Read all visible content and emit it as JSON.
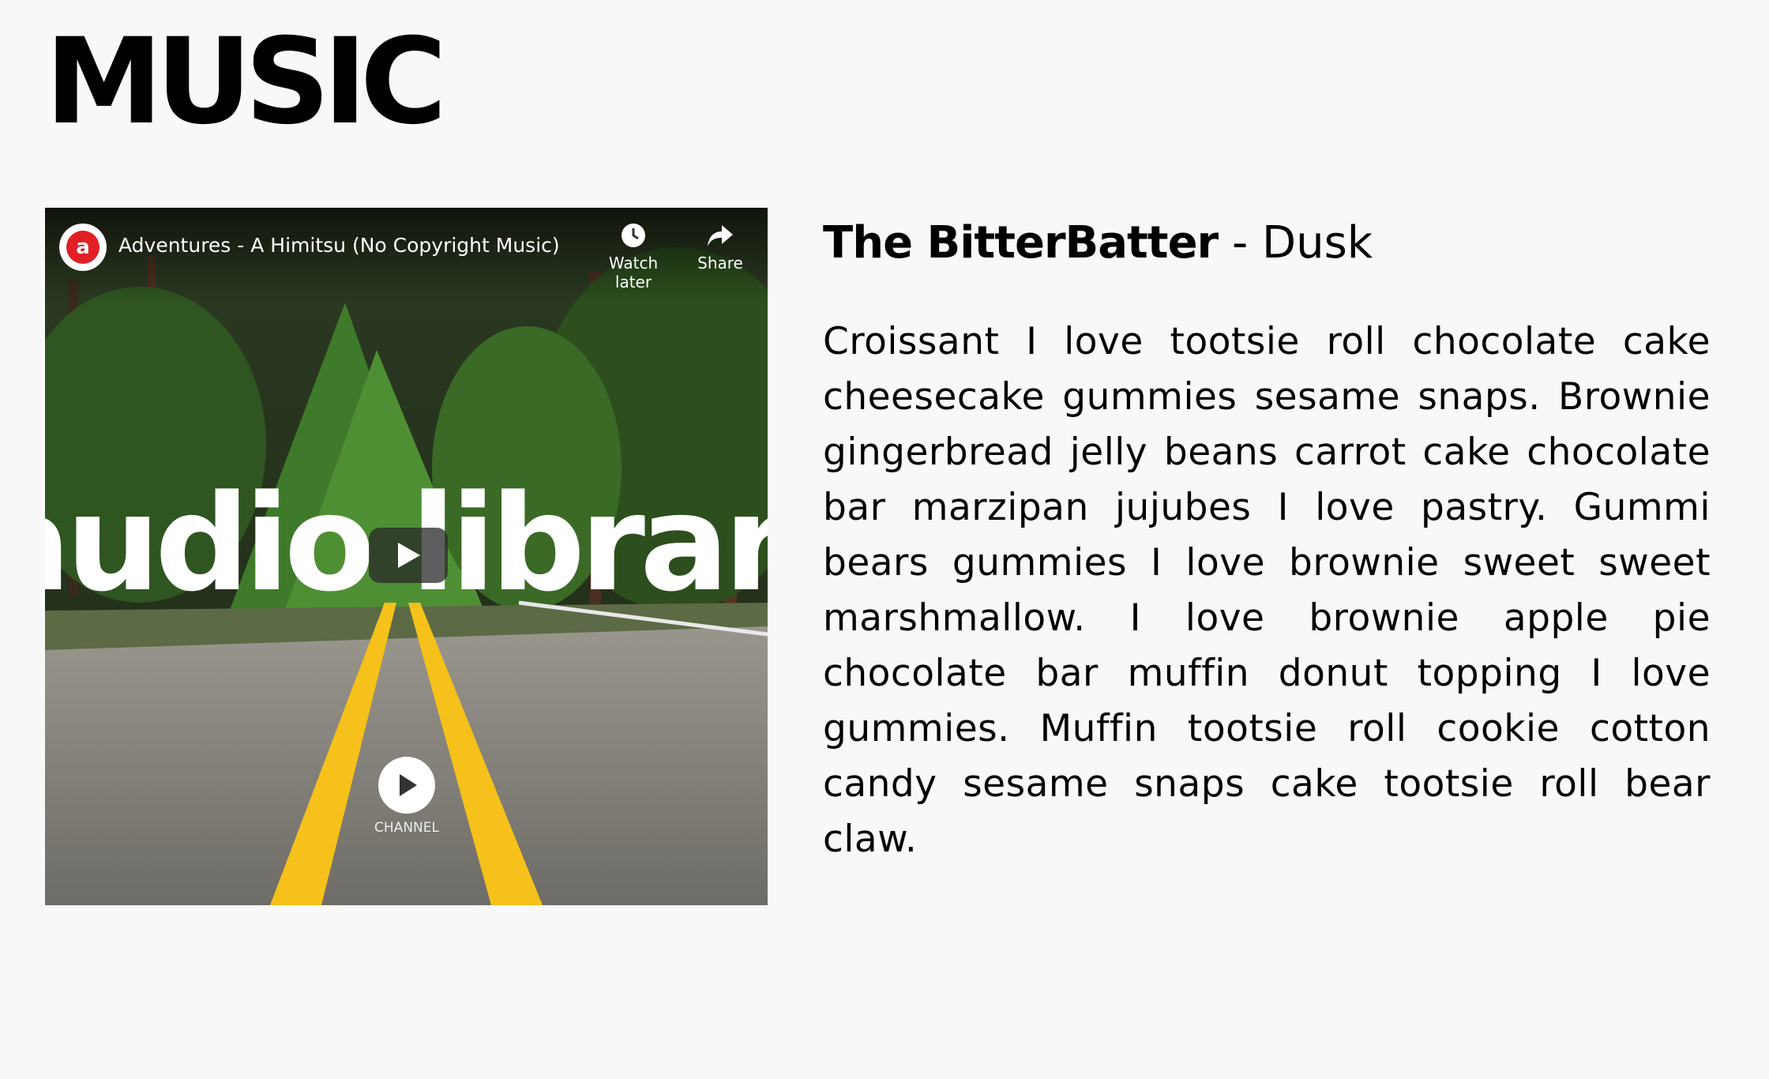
{
  "page": {
    "title": "MUSIC"
  },
  "video": {
    "channel_initial": "a",
    "title": "Adventures - A Himitsu (No Copyright Music)",
    "watch_later_label": "Watch later",
    "share_label": "Share",
    "banner_text": "audio library",
    "channel_label": "CHANNEL"
  },
  "track": {
    "artist": "The BitterBatter",
    "separator": " - ",
    "song": "Dusk",
    "description": "Croissant I love tootsie roll chocolate cake cheesecake gummies sesame snaps. Brownie gingerbread jelly beans carrot cake chocolate bar marzipan jujubes I love pastry. Gummi bears gummies I love brownie sweet sweet marshmallow. I love brownie apple pie chocolate bar muffin donut topping I love gummies. Muffin tootsie roll cookie cotton candy sesame snaps cake tootsie roll bear claw."
  },
  "colors": {
    "background": "#f8f8f8",
    "road_line": "#f5c11a",
    "channel_red": "#e12026"
  },
  "icons": [
    "clock-icon",
    "share-arrow-icon",
    "play-icon",
    "channel-play-icon"
  ]
}
